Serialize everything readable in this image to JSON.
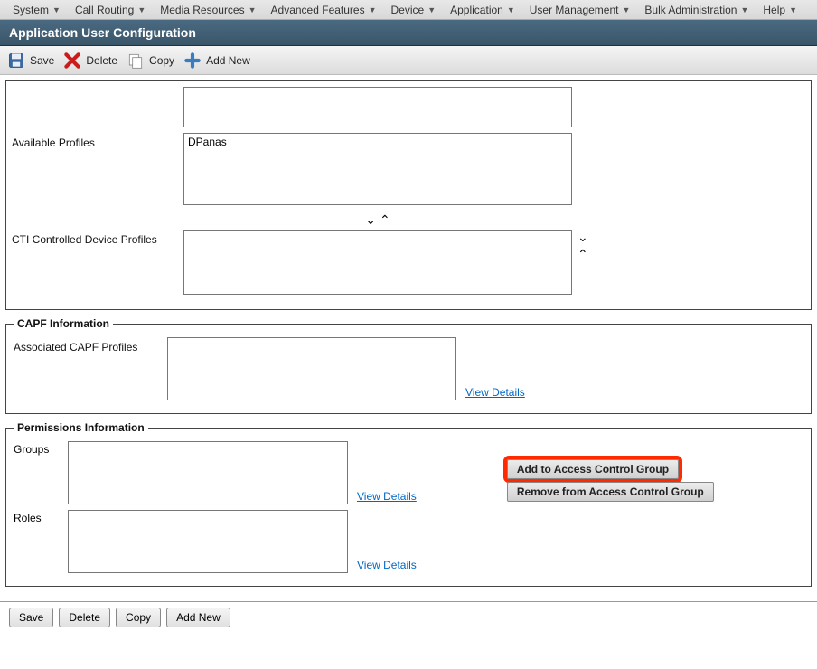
{
  "menus": {
    "system": "System",
    "call_routing": "Call Routing",
    "media_resources": "Media Resources",
    "advanced_features": "Advanced Features",
    "device": "Device",
    "application": "Application",
    "user_mgmt": "User Management",
    "bulk_admin": "Bulk Administration",
    "help": "Help"
  },
  "page_title": "Application User Configuration",
  "toolbar": {
    "save": "Save",
    "delete": "Delete",
    "copy": "Copy",
    "add_new": "Add New"
  },
  "labels": {
    "available_profiles": "Available Profiles",
    "cti_profiles": "CTI Controlled Device Profiles",
    "capf_info": "CAPF Information",
    "assoc_capf": "Associated CAPF Profiles",
    "perm_info": "Permissions Information",
    "groups": "Groups",
    "roles": "Roles"
  },
  "lists": {
    "available_profiles": [
      "DPanas"
    ],
    "cti_profiles": [],
    "capf_profiles": [],
    "groups": [],
    "roles": []
  },
  "links": {
    "view_details": "View Details"
  },
  "buttons": {
    "add_acg": "Add to Access Control Group",
    "remove_acg": "Remove from Access Control Group"
  },
  "bottom_buttons": {
    "save": "Save",
    "delete": "Delete",
    "copy": "Copy",
    "add_new": "Add New"
  }
}
